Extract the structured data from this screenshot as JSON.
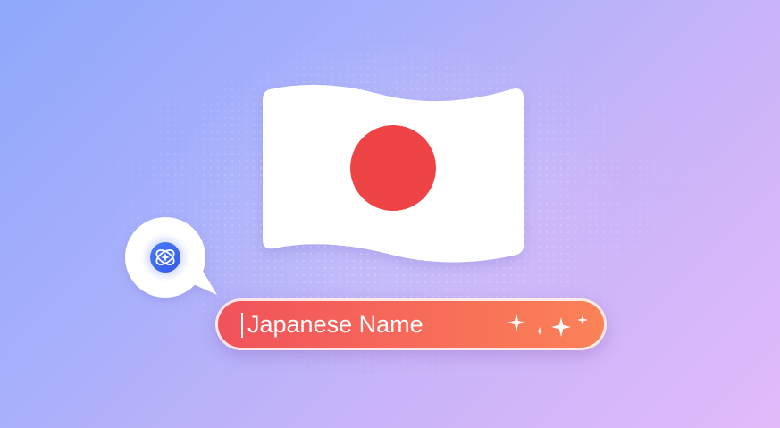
{
  "scene": {
    "colors": {
      "background_start": "#8fa8fb",
      "background_end": "#e2bafa",
      "flag_white": "#ffffff",
      "flag_red": "#ef4446",
      "pill_start": "#f0525a",
      "pill_end": "#fb8257",
      "badge_blue": "#3f6ff0"
    }
  },
  "flag": {
    "icon": "japan-flag-icon"
  },
  "assistant": {
    "icon": "ai-assistant-icon"
  },
  "name_field": {
    "value": "Japanese Name",
    "icon": "sparkles-icon"
  }
}
